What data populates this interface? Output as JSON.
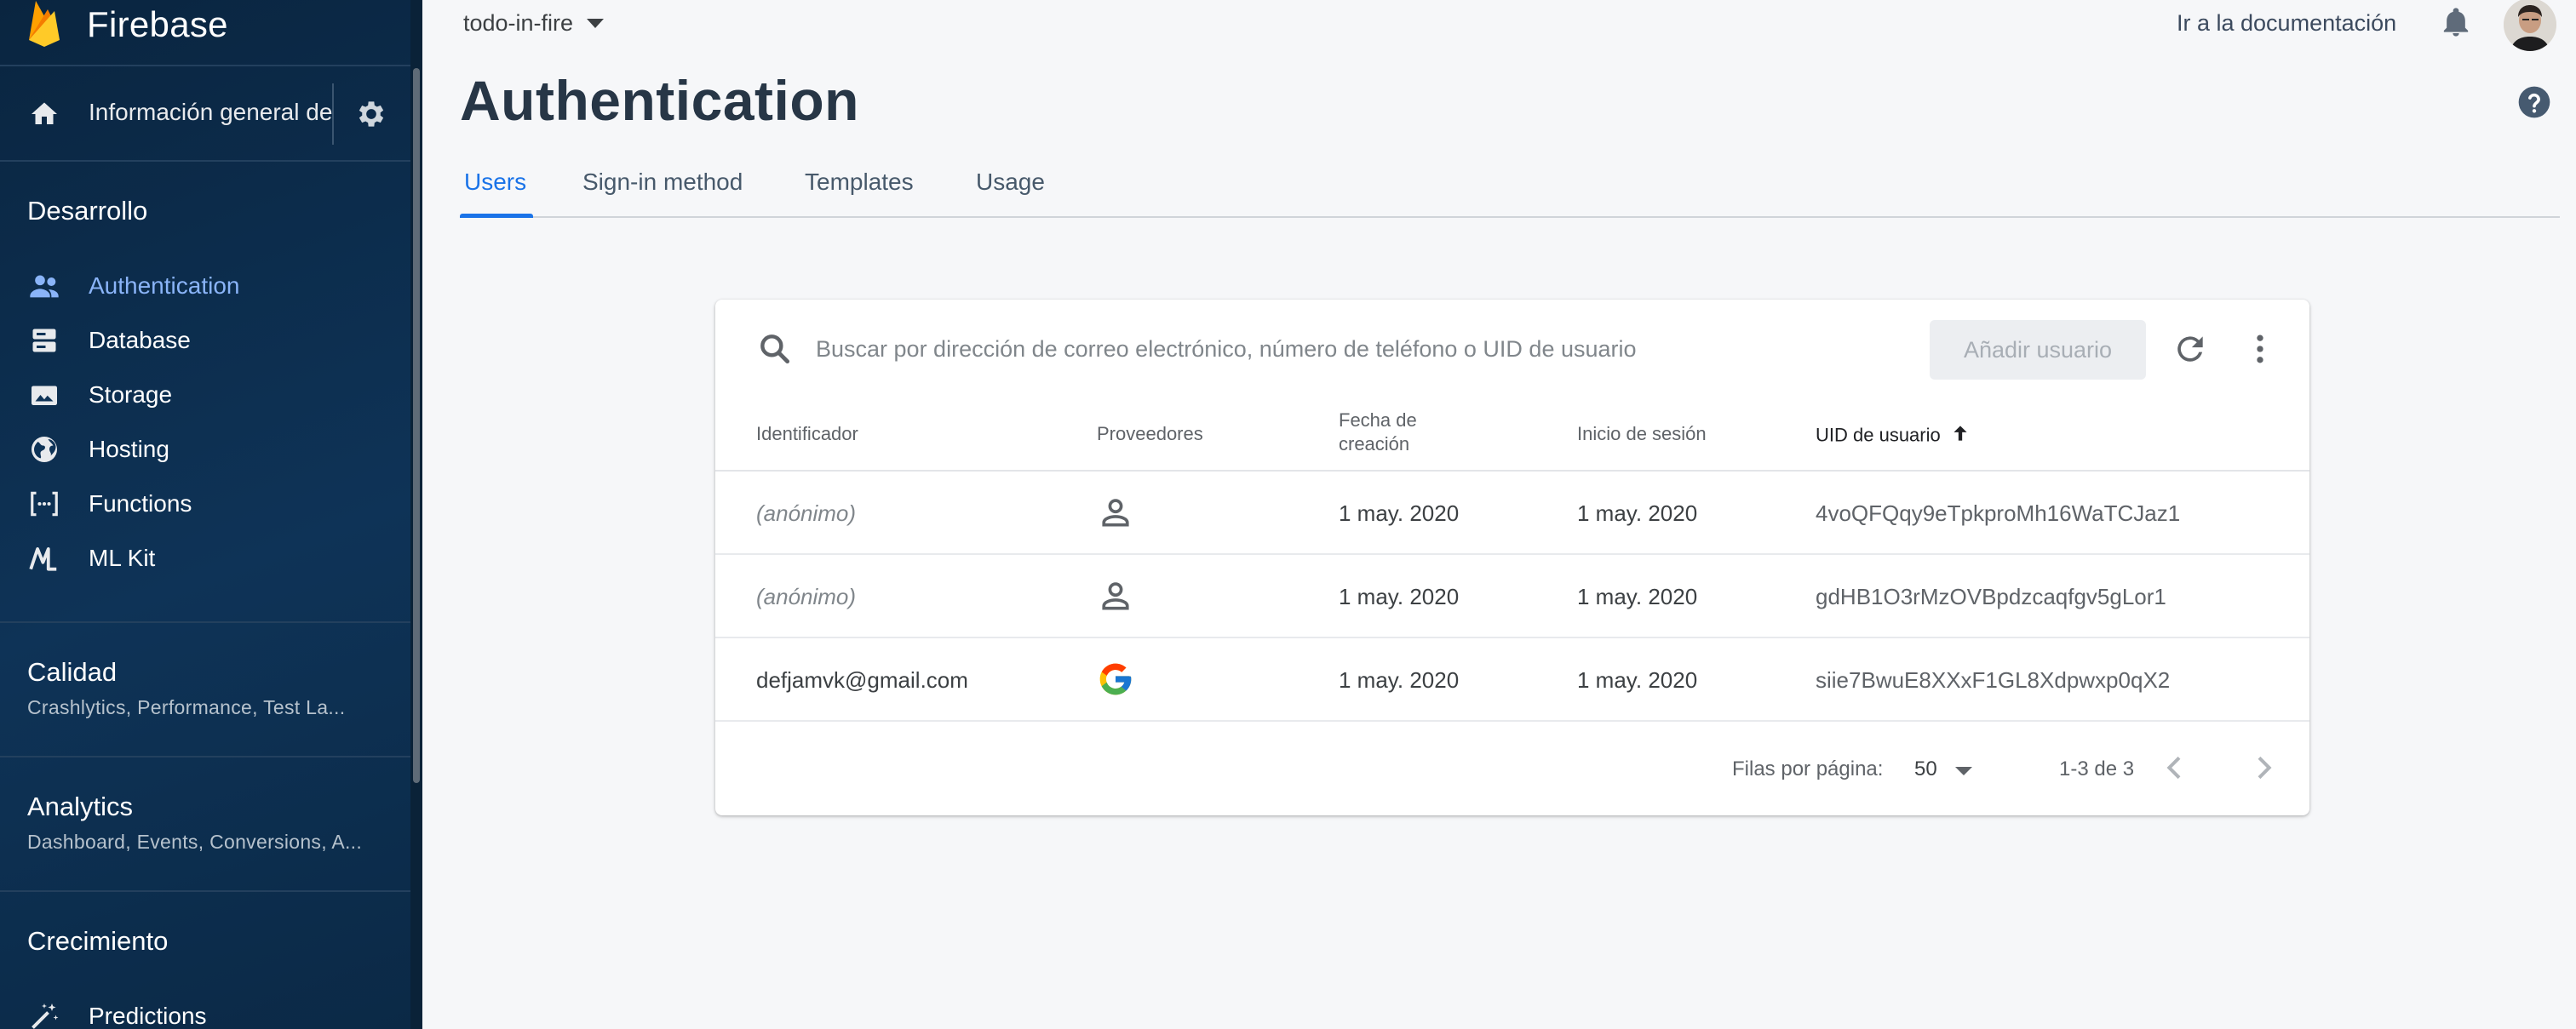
{
  "brand": {
    "name": "Firebase"
  },
  "sidebar": {
    "overview_label": "Información general del proyecto",
    "sections": {
      "develop": {
        "title": "Desarrollo"
      },
      "quality": {
        "title": "Calidad",
        "subtitle": "Crashlytics, Performance, Test La..."
      },
      "analytics": {
        "title": "Analytics",
        "subtitle": "Dashboard, Events, Conversions, A..."
      },
      "growth": {
        "title": "Crecimiento"
      }
    },
    "items": [
      {
        "label": "Authentication",
        "icon": "people-icon",
        "active": true
      },
      {
        "label": "Database",
        "icon": "database-icon"
      },
      {
        "label": "Storage",
        "icon": "storage-icon"
      },
      {
        "label": "Hosting",
        "icon": "globe-icon"
      },
      {
        "label": "Functions",
        "icon": "functions-icon"
      },
      {
        "label": "ML Kit",
        "icon": "mlkit-icon"
      }
    ],
    "growth_items": [
      {
        "label": "Predictions",
        "icon": "magic-wand-icon"
      }
    ]
  },
  "topbar": {
    "project": "todo-in-fire",
    "docs_link": "Ir a la documentación"
  },
  "page": {
    "title": "Authentication"
  },
  "tabs": [
    {
      "label": "Users",
      "active": true
    },
    {
      "label": "Sign-in method"
    },
    {
      "label": "Templates"
    },
    {
      "label": "Usage"
    }
  ],
  "users_table": {
    "search_placeholder": "Buscar por dirección de correo electrónico, número de teléfono o UID de usuario",
    "add_user_label": "Añadir usuario",
    "columns": {
      "identifier": "Identificador",
      "providers": "Proveedores",
      "created_line1": "Fecha de",
      "created_line2": "creación",
      "signed_in": "Inicio de sesión",
      "uid": "UID de usuario"
    },
    "rows": [
      {
        "identifier": "(anónimo)",
        "provider": "anonymous",
        "created": "1 may. 2020",
        "signed_in": "1 may. 2020",
        "uid": "4voQFQqy9eTpkproMh16WaTCJaz1"
      },
      {
        "identifier": "(anónimo)",
        "provider": "anonymous",
        "created": "1 may. 2020",
        "signed_in": "1 may. 2020",
        "uid": "gdHB1O3rMzOVBpdzcaqfgv5gLor1"
      },
      {
        "identifier": "defjamvk@gmail.com",
        "provider": "google",
        "created": "1 may. 2020",
        "signed_in": "1 may. 2020",
        "uid": "siie7BwuE8XXxF1GL8Xdpwxp0qX2"
      }
    ],
    "footer": {
      "rows_per_page_label": "Filas por página:",
      "rows_per_page_value": "50",
      "range": "1-3 de 3"
    }
  },
  "colors": {
    "accent": "#1a73e8",
    "sidebar_bg": "#0e3357",
    "active_nav": "#8ab4f8",
    "firebase_yellow": "#ffca28",
    "firebase_orange": "#f57c00"
  }
}
